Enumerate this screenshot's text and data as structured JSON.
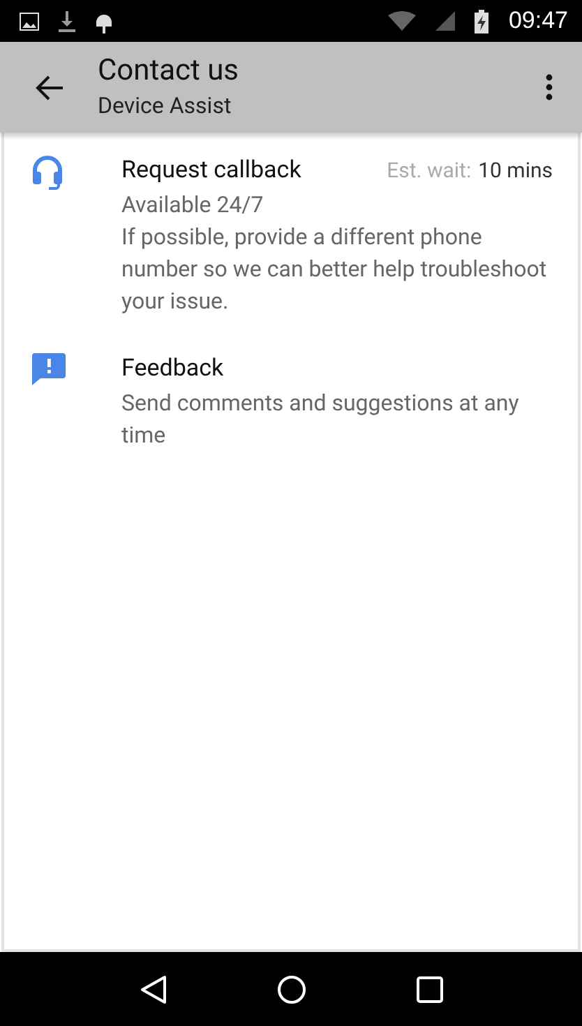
{
  "status_bar": {
    "time": "09:47"
  },
  "app_bar": {
    "title": "Contact us",
    "subtitle": "Device Assist"
  },
  "items": [
    {
      "kind": "callback",
      "title": "Request callback",
      "wait_label": "Est. wait:",
      "wait_value": "10 mins",
      "lines": [
        "Available 24/7",
        "If possible, provide a different phone number so we can better help troubleshoot your issue."
      ]
    },
    {
      "kind": "feedback",
      "title": "Feedback",
      "lines": [
        "Send comments and suggestions at any time"
      ]
    }
  ]
}
